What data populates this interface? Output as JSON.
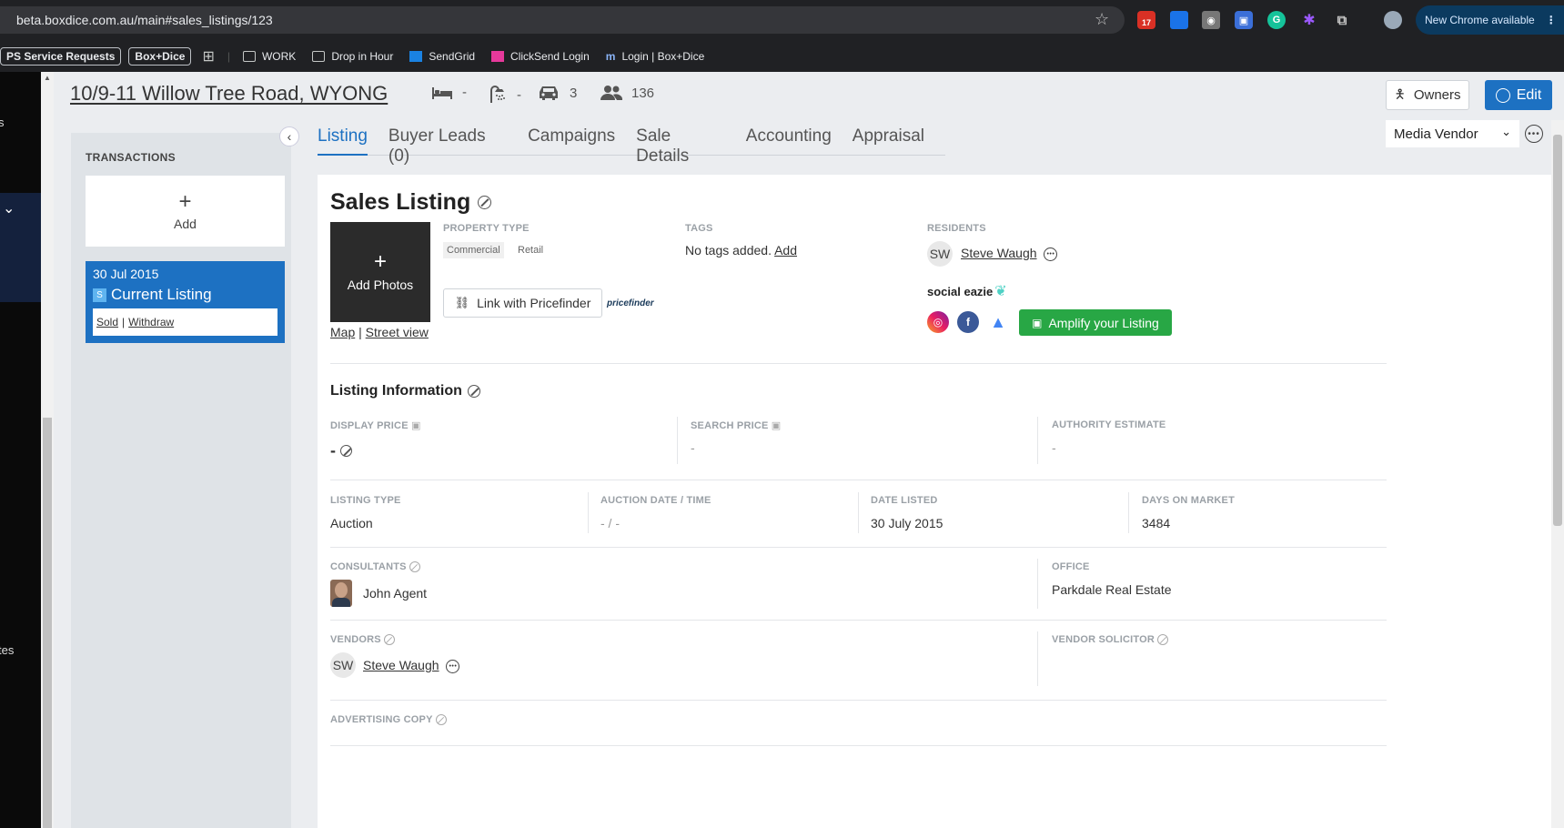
{
  "browser": {
    "url": "beta.boxdice.com.au/main#sales_listings/123",
    "new_chrome": "New Chrome available",
    "calendar_badge": "17",
    "bookmarks": [
      "PS Service Requests",
      "Box+Dice",
      "WORK",
      "Drop in Hour",
      "SendGrid",
      "ClickSend Login",
      "Login | Box+Dice"
    ]
  },
  "leftnav": {
    "partial_labels": [
      "s",
      "tes"
    ]
  },
  "header": {
    "address": "10/9-11 Willow Tree Road, WYONG",
    "beds": "-",
    "baths": "-",
    "cars": "3",
    "contacts": "136",
    "owners_label": "Owners",
    "edit_label": "Edit"
  },
  "transactions": {
    "title": "TRANSACTIONS",
    "add_label": "Add",
    "card": {
      "date": "30 Jul 2015",
      "badge": "S",
      "title": "Current Listing",
      "sold": "Sold",
      "sep": "|",
      "withdraw": "Withdraw"
    }
  },
  "tabs": [
    "Listing",
    "Buyer Leads (0)",
    "Campaigns",
    "Sale Details",
    "Accounting",
    "Appraisal"
  ],
  "media_vendor": "Media Vendor",
  "listing": {
    "title": "Sales Listing",
    "add_photos": "Add Photos",
    "map": "Map",
    "map_sep": "|",
    "street_view": "Street view",
    "property_type_label": "PROPERTY TYPE",
    "property_types": [
      "Commercial",
      "Retail"
    ],
    "pricefinder_btn": "Link with Pricefinder",
    "pricefinder_logo": "pricefinder",
    "tags_label": "TAGS",
    "tags_value": "No tags added.",
    "tags_add": "Add",
    "residents_label": "RESIDENTS",
    "resident_initials": "SW",
    "resident_name": "Steve Waugh",
    "social_brand": "social eazie",
    "amplify": "Amplify your Listing"
  },
  "info": {
    "title": "Listing Information",
    "display_price_label": "DISPLAY PRICE",
    "display_price": "-",
    "search_price_label": "SEARCH PRICE",
    "search_price": "-",
    "authority_label": "AUTHORITY ESTIMATE",
    "authority": "-",
    "listing_type_label": "LISTING TYPE",
    "listing_type": "Auction",
    "auction_label": "AUCTION DATE / TIME",
    "auction": "- / -",
    "date_listed_label": "DATE LISTED",
    "date_listed": "30 July 2015",
    "dom_label": "DAYS ON MARKET",
    "dom": "3484",
    "consultants_label": "CONSULTANTS",
    "consultant": "John Agent",
    "office_label": "OFFICE",
    "office": "Parkdale Real Estate",
    "vendors_label": "VENDORS",
    "vendor_initials": "SW",
    "vendor": "Steve Waugh",
    "vendor_solicitor_label": "VENDOR SOLICITOR",
    "adcopy_label": "ADVERTISING COPY"
  },
  "colors": {
    "primary": "#1d71c2",
    "success": "#28a745",
    "page_bg": "#ebedf0"
  }
}
